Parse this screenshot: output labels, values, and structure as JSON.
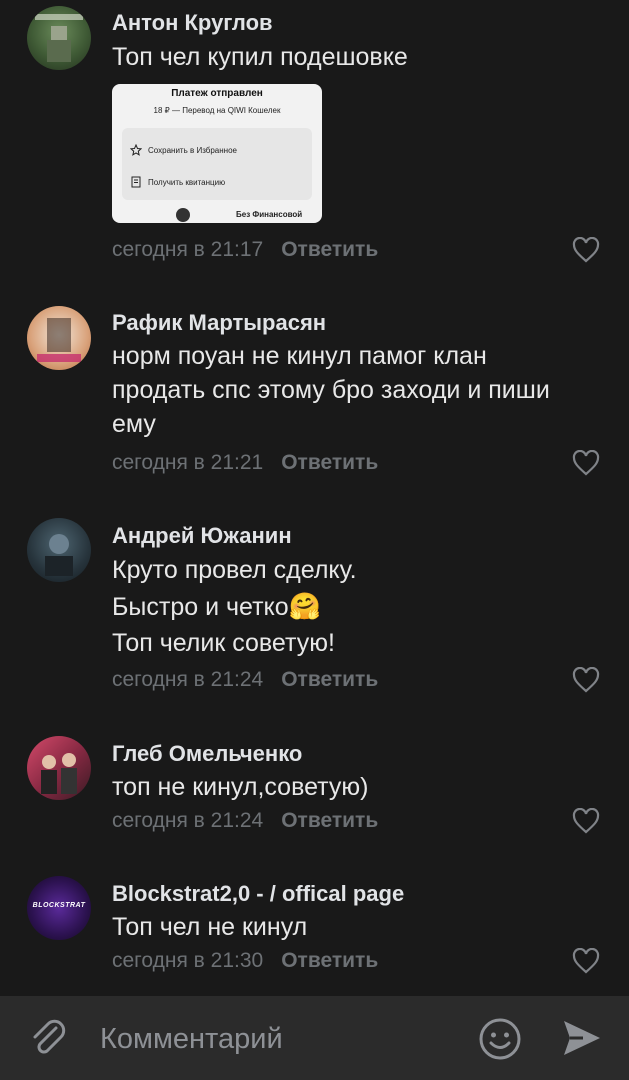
{
  "comments": [
    {
      "author": "Антон Круглов",
      "lines": [
        "Топ чел купил подешовке"
      ],
      "time": "сегодня в 21:17",
      "reply": "Ответить",
      "attachment": {
        "title": "Платеж отправлен",
        "subtitle": "18 ₽ — Перевод на QIWI Кошелек",
        "actions": [
          "Сохранить в Избранное",
          "Получить квитанцию"
        ],
        "footer": "Без Финансовой"
      }
    },
    {
      "author": "Рафик Мартырасян",
      "lines": [
        "норм поуан не кинул памог клан",
        "продать спс этому бро заходи и пиши",
        "ему"
      ],
      "time": "сегодня в 21:21",
      "reply": "Ответить"
    },
    {
      "author": "Андрей Южанин",
      "lines": [
        "Круто провел сделку.",
        "Быстро и четко",
        "Топ челик советую!"
      ],
      "emoji": "🤗",
      "time": "сегодня в 21:24",
      "reply": "Ответить"
    },
    {
      "author": "Глеб Омельченко",
      "lines": [
        "топ не кинул,советую)"
      ],
      "time": "сегодня в 21:24",
      "reply": "Ответить"
    },
    {
      "author": "Blockstrat2,0 - / offical page",
      "lines": [
        "Топ чел не кинул"
      ],
      "time": "сегодня в 21:30",
      "reply": "Ответить",
      "avatar_text": "BLOCKSTRAT"
    }
  ],
  "composer": {
    "placeholder": "Комментарий",
    "icons": [
      "paperclip-icon",
      "emoji-icon",
      "send-icon"
    ]
  },
  "colors": {
    "background": "#191919",
    "composer": "#2b2b2b",
    "meta": "#6d7175",
    "text": "#e1e3e6"
  }
}
